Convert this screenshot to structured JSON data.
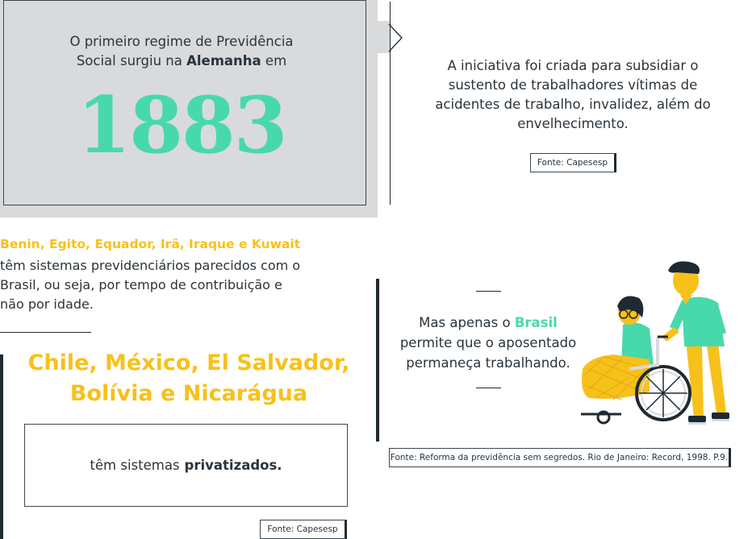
{
  "top_left": {
    "line1": "O primeiro regime de Previdência",
    "line2_pre": "Social surgiu na ",
    "line2_bold": "Alemanha",
    "line2_post": " em",
    "year": "1883"
  },
  "top_right": {
    "text": "A iniciativa foi criada para subsidiar o sustento de trabalhadores vítimas de acidentes de trabalho, invalidez, além do envelhecimento.",
    "source": "Fonte: Capesesp"
  },
  "middle_left": {
    "countries": "Benin, Egito, Equador, Irã, Iraque e Kuwait",
    "text": "têm sistemas previdenciários parecidos com o Brasil, ou seja, por tempo de contribuição e não por idade."
  },
  "bottom_left": {
    "title": "Chile, México, El Salvador, Bolívia e Nicarágua",
    "text_pre": "têm sistemas",
    "text_bold": "privatizados.",
    "source": "Fonte: Capesesp"
  },
  "bottom_right": {
    "line1_pre": "Mas apenas o ",
    "line1_highlight": "Brasil",
    "line2": "permite que o aposentado",
    "line3": "permaneça trabalhando.",
    "source": "Fonte: Reforma da previdência sem segredos. Rio de Janeiro: Record, 1998. P.9."
  },
  "colors": {
    "accent_green": "#47d9ac",
    "accent_yellow": "#f7c11b",
    "panel_grey": "#d9dadc",
    "dark": "#1e2a32"
  }
}
